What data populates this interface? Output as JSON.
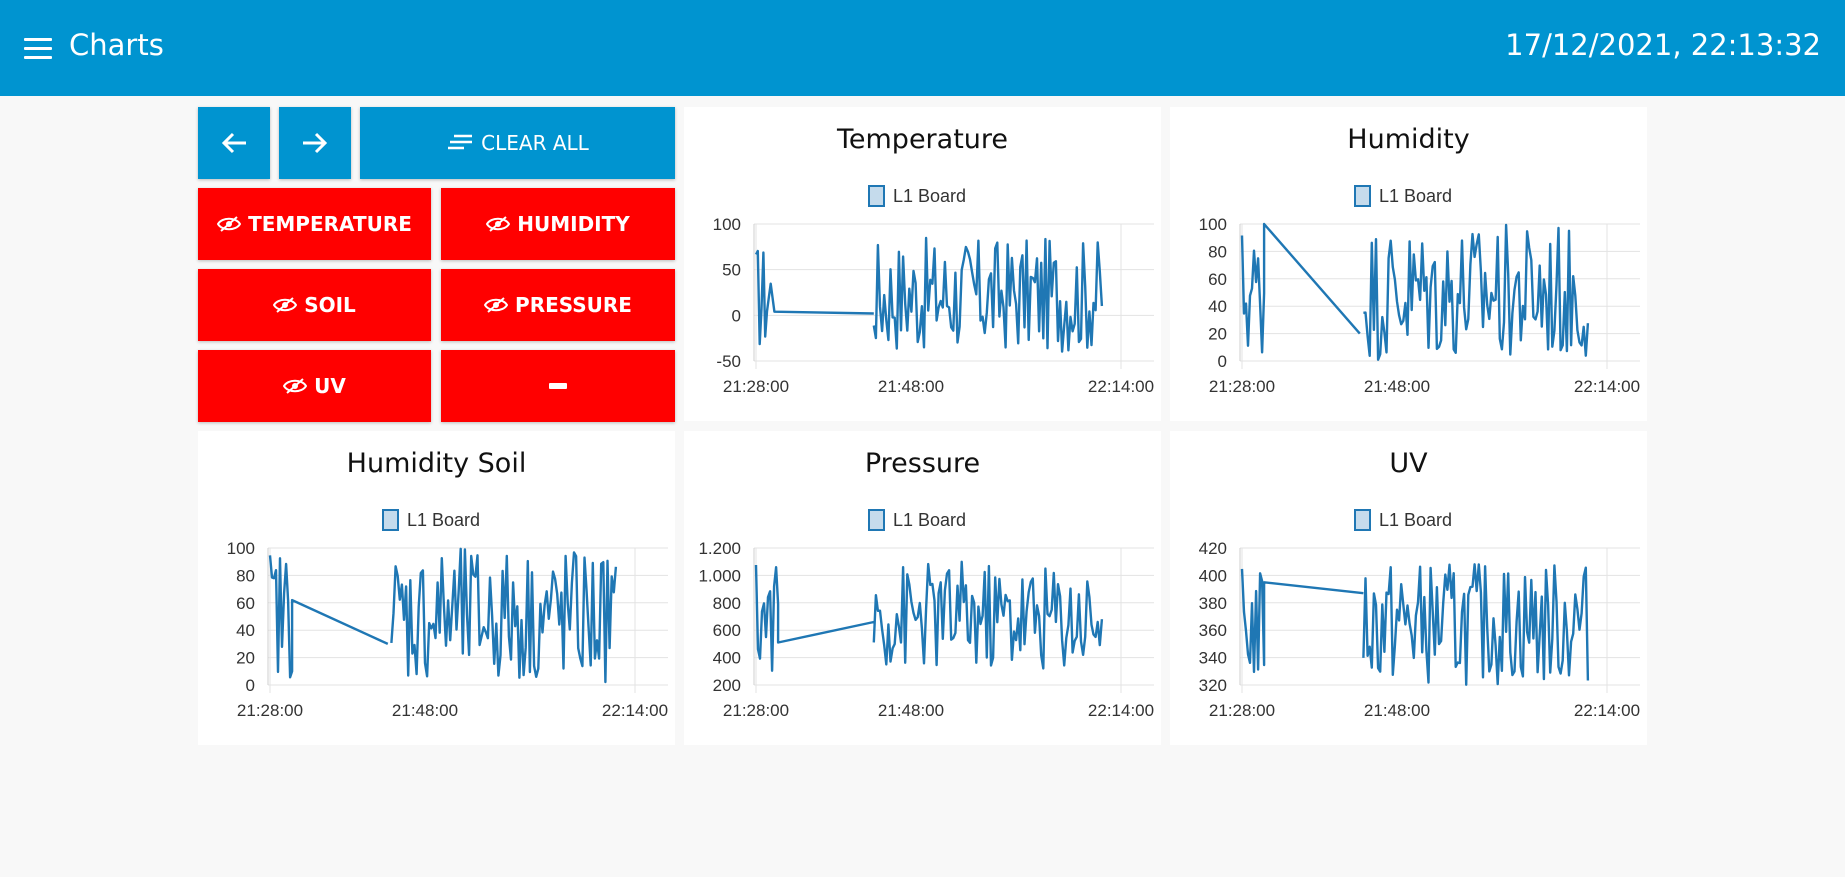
{
  "header": {
    "title": "Charts",
    "datetime": "17/12/2021, 22:13:32"
  },
  "controls": {
    "clear_all_label": "CLEAR ALL",
    "toggle_labels": [
      "TEMPERATURE",
      "HUMIDITY",
      "SOIL",
      "PRESSURE",
      "UV"
    ],
    "minus_label": "−"
  },
  "colors": {
    "accent": "#0094d0",
    "danger": "#ff0000",
    "series": "#1f77b4",
    "background": "#f8f8f8"
  },
  "icons": {
    "menu": "hamburger-icon",
    "back": "arrow-left-icon",
    "forward": "arrow-right-icon",
    "clear": "clear-lines-icon",
    "toggle": "eye-slash-icon",
    "minus": "minus-icon"
  },
  "chart_data": [
    {
      "type": "line",
      "title": "Temperature",
      "legend": "L1 Board",
      "x_ticks": [
        "21:28:00",
        "21:48:00",
        "22:14:00"
      ],
      "y_ticks": [
        "100",
        "50",
        "0",
        "-50"
      ],
      "ylim": [
        -50,
        100
      ],
      "series": [
        {
          "name": "L1 Board",
          "segments": [
            {
              "x": [
                0,
                0.04
              ],
              "ymin": -40,
              "ymax": 80
            },
            {
              "x": [
                0.32,
                0.94
              ],
              "ymin": -40,
              "ymax": 85
            }
          ],
          "connector": [
            [
              0.05,
              4
            ],
            [
              0.32,
              2
            ]
          ]
        }
      ]
    },
    {
      "type": "line",
      "title": "Humidity",
      "legend": "L1 Board",
      "x_ticks": [
        "21:28:00",
        "21:48:00",
        "22:14:00"
      ],
      "y_ticks": [
        "100",
        "80",
        "60",
        "40",
        "20",
        "0"
      ],
      "ylim": [
        0,
        100
      ],
      "series": [
        {
          "name": "L1 Board",
          "segments": [
            {
              "x": [
                0,
                0.06
              ],
              "ymin": 0,
              "ymax": 100
            },
            {
              "x": [
                0.33,
                0.94
              ],
              "ymin": 0,
              "ymax": 100
            }
          ],
          "connector": [
            [
              0.06,
              100
            ],
            [
              0.32,
              20
            ]
          ]
        }
      ]
    },
    {
      "type": "line",
      "title": "Humidity Soil",
      "legend": "L1 Board",
      "x_ticks": [
        "21:28:00",
        "21:48:00",
        "22:14:00"
      ],
      "y_ticks": [
        "100",
        "80",
        "60",
        "40",
        "20",
        "0"
      ],
      "ylim": [
        0,
        100
      ],
      "series": [
        {
          "name": "L1 Board",
          "segments": [
            {
              "x": [
                0,
                0.06
              ],
              "ymin": 5,
              "ymax": 100
            },
            {
              "x": [
                0.33,
                0.94
              ],
              "ymin": 0,
              "ymax": 100
            }
          ],
          "connector": [
            [
              0.06,
              62
            ],
            [
              0.32,
              30
            ]
          ]
        }
      ]
    },
    {
      "type": "line",
      "title": "Pressure",
      "legend": "L1 Board",
      "x_ticks": [
        "21:28:00",
        "21:48:00",
        "22:14:00"
      ],
      "y_ticks": [
        "1.200",
        "1.000",
        "800",
        "600",
        "400",
        "200"
      ],
      "ylim": [
        200,
        1200
      ],
      "series": [
        {
          "name": "L1 Board",
          "segments": [
            {
              "x": [
                0,
                0.06
              ],
              "ymin": 300,
              "ymax": 1100
            },
            {
              "x": [
                0.32,
                0.94
              ],
              "ymin": 300,
              "ymax": 1100
            }
          ],
          "connector": [
            [
              0.06,
              510
            ],
            [
              0.32,
              660
            ]
          ]
        }
      ]
    },
    {
      "type": "line",
      "title": "UV",
      "legend": "L1 Board",
      "x_ticks": [
        "21:28:00",
        "21:48:00",
        "22:14:00"
      ],
      "y_ticks": [
        "420",
        "400",
        "380",
        "360",
        "340",
        "320"
      ],
      "ylim": [
        320,
        420
      ],
      "series": [
        {
          "name": "L1 Board",
          "segments": [
            {
              "x": [
                0,
                0.06
              ],
              "ymin": 320,
              "ymax": 405
            },
            {
              "x": [
                0.33,
                0.94
              ],
              "ymin": 320,
              "ymax": 410
            }
          ],
          "connector": [
            [
              0.06,
              395
            ],
            [
              0.33,
              387
            ]
          ]
        }
      ]
    }
  ]
}
